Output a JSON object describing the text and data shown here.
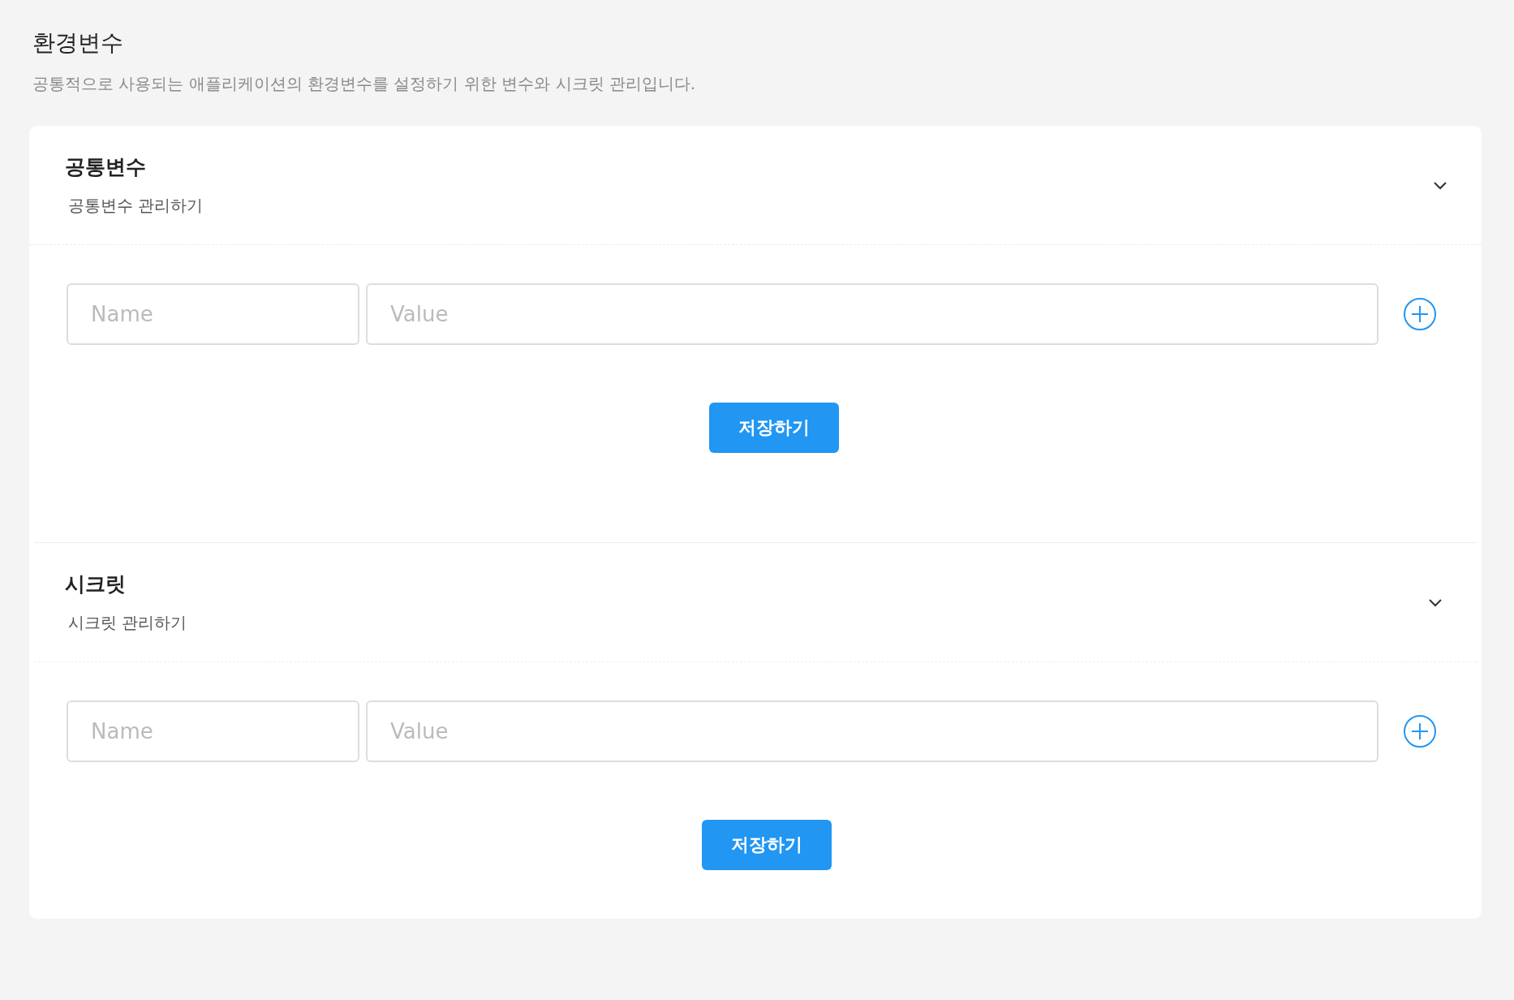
{
  "page": {
    "title": "환경변수",
    "description": "공통적으로 사용되는 애플리케이션의 환경변수를 설정하기 위한 변수와 시크릿 관리입니다."
  },
  "sections": [
    {
      "title": "공통변수",
      "subtitle": "공통변수 관리하기",
      "expanded": true,
      "name_placeholder": "Name",
      "value_placeholder": "Value",
      "save_label": "저장하기"
    },
    {
      "title": "시크릿",
      "subtitle": "시크릿 관리하기",
      "expanded": true,
      "name_placeholder": "Name",
      "value_placeholder": "Value",
      "save_label": "저장하기"
    }
  ]
}
